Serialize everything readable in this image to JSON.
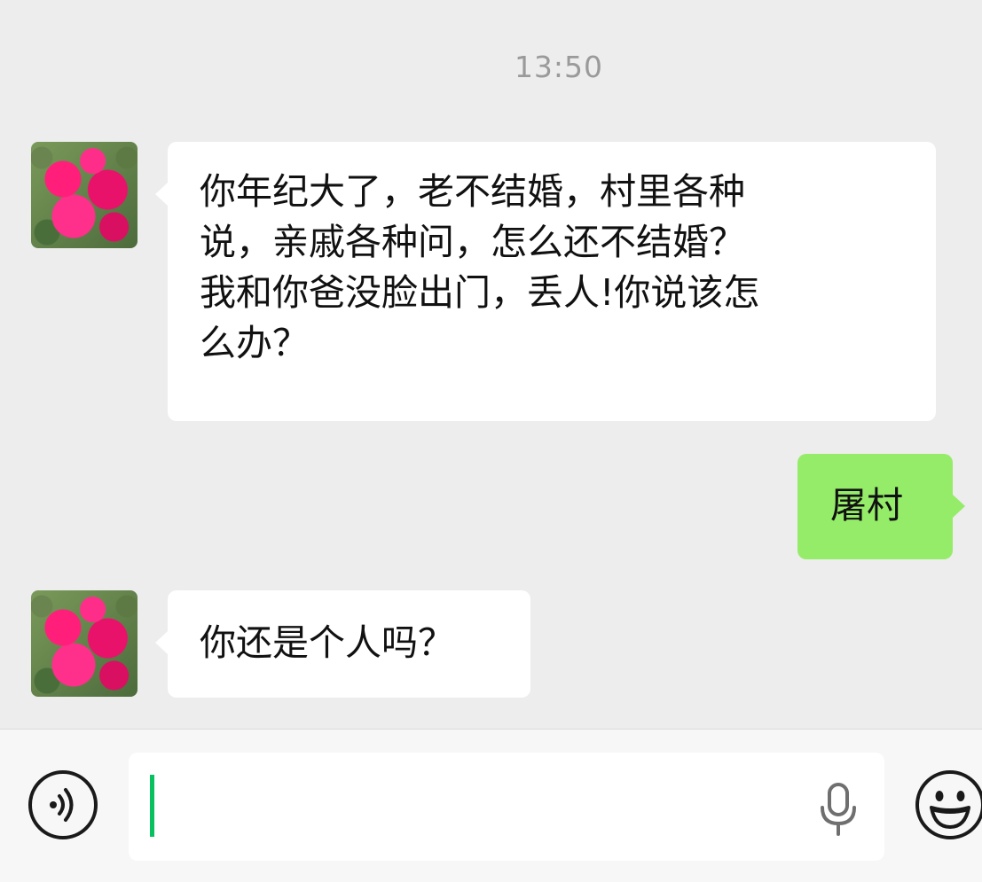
{
  "conversation": {
    "timestamp": "13:50",
    "messages": [
      {
        "sender": "contact",
        "lines": [
          "你年纪大了，老不结婚，村里各种",
          "说，亲戚各种问，怎么还不结婚？",
          "我和你爸没脸出门，丢人!你说该怎",
          "么办？"
        ]
      },
      {
        "sender": "me",
        "lines": [
          "屠村"
        ]
      },
      {
        "sender": "contact",
        "lines": [
          "你还是个人吗？"
        ]
      }
    ]
  },
  "input_bar": {
    "value": "",
    "icons": {
      "voice": "voice-wave-icon",
      "mic": "microphone-icon",
      "emoji": "smiley-face-icon"
    }
  },
  "colors": {
    "background": "#ededed",
    "incoming_bubble": "#ffffff",
    "outgoing_bubble": "#95ec69",
    "caret": "#07c160",
    "timestamp": "#9a9a9a"
  }
}
